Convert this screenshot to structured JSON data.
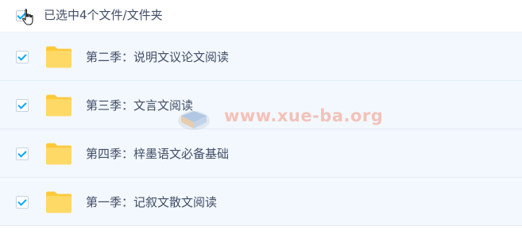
{
  "header": {
    "selection_text": "已选中4个文件/文件夹",
    "select_all_checked": true
  },
  "items": [
    {
      "label": "第二季：说明文议论文阅读",
      "type": "folder",
      "checked": true
    },
    {
      "label": "第三季：文言文阅读",
      "type": "folder",
      "checked": true
    },
    {
      "label": "第四季：梓墨语文必备基础",
      "type": "folder",
      "checked": true
    },
    {
      "label": "第一季：记叙文散文阅读",
      "type": "folder",
      "checked": true
    }
  ],
  "watermark": {
    "text": "www.xue-ba.org",
    "logo_icon": "book-logo-icon"
  },
  "colors": {
    "accent": "#06a7ff",
    "folder": "#ffd158",
    "row_bg": "#f3f8fe",
    "text": "#424e67"
  }
}
